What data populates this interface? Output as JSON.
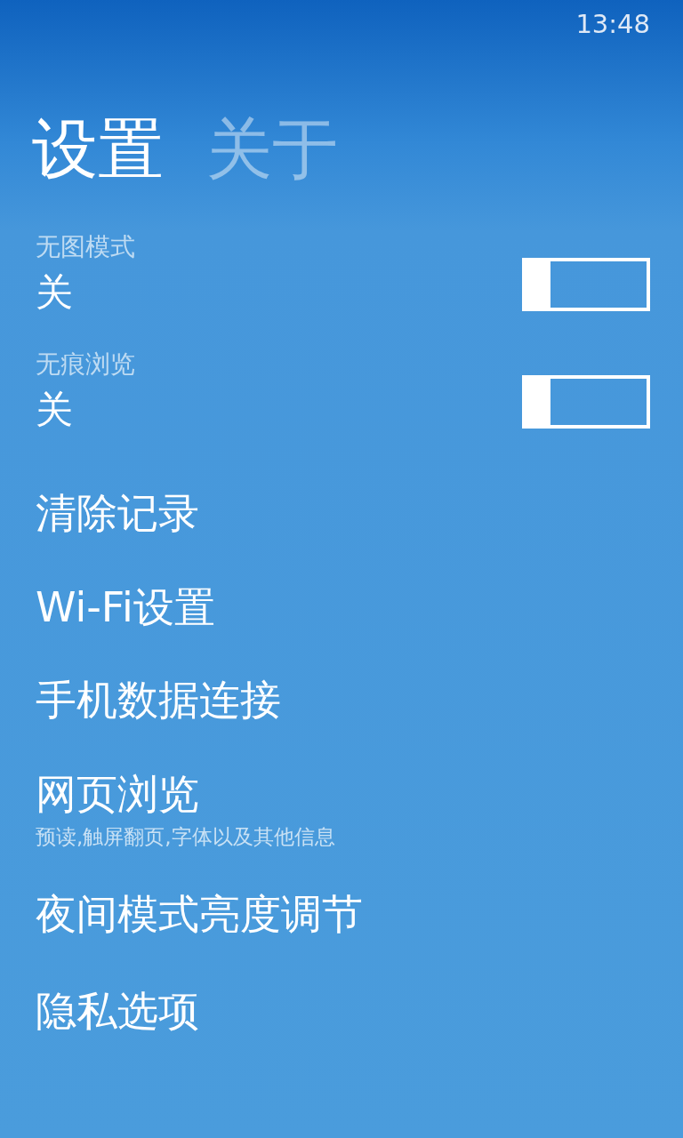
{
  "status_bar": {
    "time": "13:48"
  },
  "pivots": [
    {
      "label": "设置",
      "selected": true
    },
    {
      "label": "关于",
      "selected": false
    }
  ],
  "toggles": [
    {
      "label": "无图模式",
      "value": "关",
      "on": false
    },
    {
      "label": "无痕浏览",
      "value": "关",
      "on": false
    }
  ],
  "items": [
    {
      "title": "清除记录"
    },
    {
      "title": "Wi-Fi设置"
    },
    {
      "title": "手机数据连接"
    },
    {
      "title": "网页浏览",
      "subtitle": "预读,触屏翻页,字体以及其他信息"
    },
    {
      "title": "夜间模式亮度调节"
    },
    {
      "title": "隐私选项"
    }
  ]
}
